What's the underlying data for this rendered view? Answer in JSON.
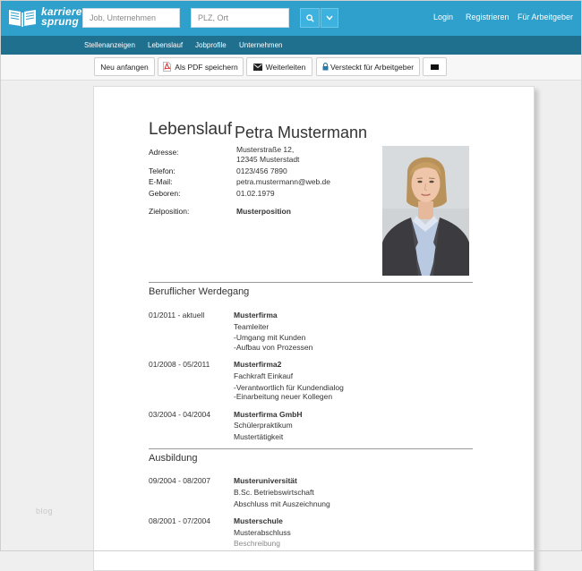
{
  "header": {
    "logo_line1": "karriere",
    "logo_line2": "sprung",
    "job_input_placeholder": "Job, Unternehmen",
    "location_input_placeholder": "PLZ, Ort",
    "links": [
      "Login",
      "Registrieren",
      "Für Arbeitgeber"
    ],
    "bg_color": "#2f9fcb"
  },
  "subnav": {
    "items": [
      "Stellenanzeigen",
      "Lebenslauf",
      "Jobprofile",
      "Unternehmen"
    ],
    "bg_color": "#1f6f8f"
  },
  "toolbar": {
    "new_label": "Neu anfangen",
    "pdf_label": "Als PDF speichern",
    "forward_label": "Weiterleiten",
    "hidden_label": "Versteckt für Arbeitgeber"
  },
  "cv": {
    "heading": "Lebenslauf",
    "name": "Petra Mustermann",
    "details": {
      "address_label": "Adresse:",
      "address_line1": "Musterstraße 12,",
      "address_line2": "12345 Musterstadt",
      "phone_label": "Telefon:",
      "phone": "0123/456 7890",
      "email_label": "E-Mail:",
      "email": "petra.mustermann@web.de",
      "born_label": "Geboren:",
      "born": "01.02.1979",
      "target_label": "Zielposition:",
      "target": "Musterposition"
    },
    "career_title": "Beruflicher Werdegang",
    "career": [
      {
        "period": "01/2011 - aktuell",
        "company": "Musterfirma",
        "lines": [
          "Teamleiter",
          "-Umgang mit Kunden",
          "-Aufbau von Prozessen"
        ]
      },
      {
        "period": "01/2008 - 05/2011",
        "company": "Musterfirma2",
        "lines": [
          "Fachkraft Einkauf",
          "-Verantwortlich für Kundendialog",
          "-Einarbeitung neuer Kollegen"
        ]
      },
      {
        "period": "03/2004 - 04/2004",
        "company": "Musterfirma GmbH",
        "lines": [
          "Schülerpraktikum",
          "Mustertätigkeit"
        ]
      }
    ],
    "education_title": "Ausbildung",
    "education": [
      {
        "period": "09/2004 - 08/2007",
        "school": "Musteruniversität",
        "lines": [
          "B.Sc. Betriebswirtschaft",
          "Abschluss mit Auszeichnung"
        ]
      },
      {
        "period": "08/2001 - 07/2004",
        "school": "Musterschule",
        "lines": [
          "Musterabschluss",
          "Beschreibung"
        ]
      }
    ]
  },
  "watermark": "blog"
}
